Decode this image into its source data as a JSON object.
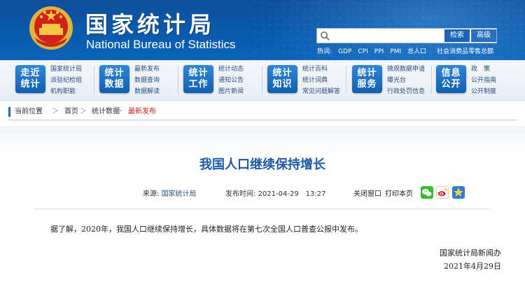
{
  "header": {
    "title_cn": "国家统计局",
    "title_en": "National Bureau of Statistics",
    "search": {
      "placeholder": "",
      "search_label": "检索",
      "advanced_label": "高级"
    },
    "hot_links": [
      "热词:",
      "GDP",
      "CPI",
      "PPI",
      "PMI",
      "总人口",
      "社会消费品零售总额"
    ]
  },
  "nav": {
    "groups": [
      {
        "tile": [
          "走近",
          "统计"
        ],
        "links": [
          "国家统计局",
          "派驻纪检组",
          "机构职能"
        ]
      },
      {
        "tile": [
          "统计",
          "数据"
        ],
        "links": [
          "最新发布",
          "数据查询",
          "数据解读"
        ]
      },
      {
        "tile": [
          "统计",
          "工作"
        ],
        "links": [
          "统计动态",
          "通知公告",
          "图片新闻"
        ]
      },
      {
        "tile": [
          "统计",
          "知识"
        ],
        "links": [
          "统计百科",
          "统计词典",
          "常见问题解答"
        ]
      },
      {
        "tile": [
          "统计",
          "服务"
        ],
        "links": [
          "微观数据申请",
          "曝光台",
          "行政处罚信息"
        ]
      },
      {
        "tile": [
          "信息",
          "公开"
        ],
        "links": [
          "政　策",
          "公开指南",
          "公开制度"
        ]
      }
    ]
  },
  "breadcrumb": {
    "items": [
      "当前位置",
      "首页",
      "统计数据",
      "最新发布"
    ],
    "separator": "＞"
  },
  "article": {
    "title": "我国人口继续保持增长",
    "source_label": "来源:",
    "source": "国家统计局",
    "time_label": "发布时间:",
    "time": "2021-04-29　13:27",
    "close_label": "关闭窗口",
    "print_label": "打印本页",
    "body": "据了解，2020年，我国人口继续保持增长，具体数据将在第七次全国人口普查公报中发布。",
    "sign_org": "国家统计局新闻办",
    "sign_date": "2021年4月29日"
  },
  "colors": {
    "header_blue": "#0b5aad",
    "title_blue": "#1e5aa6",
    "current_red": "#cc1a1a"
  }
}
